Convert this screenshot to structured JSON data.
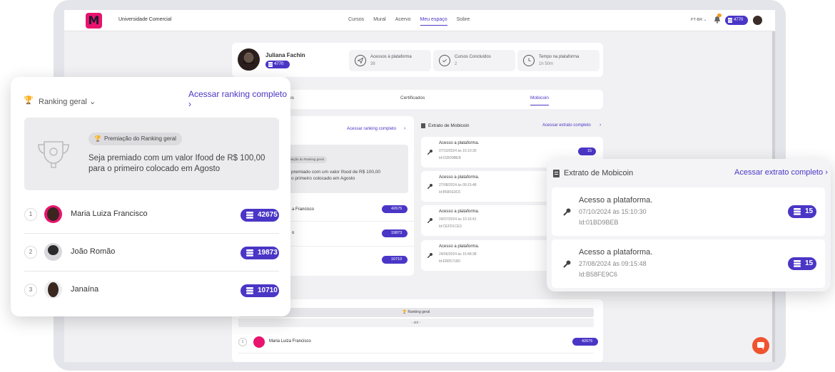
{
  "header": {
    "org_name": "Universidade Comercial",
    "nav": [
      "Cursos",
      "Mural",
      "Acervo",
      "Meu espaço",
      "Sobre"
    ],
    "lang": "PT-BR",
    "coins": "4770"
  },
  "profile": {
    "name": "Juliana Fachin",
    "coins": "4770",
    "stats": [
      {
        "label": "Acessos à plataforma",
        "value": "38"
      },
      {
        "label": "Cursos Concluídos",
        "value": "2"
      },
      {
        "label": "Tempo na plataforma",
        "value": "1h 50m"
      }
    ]
  },
  "tabs": {
    "cut_label": "os",
    "certificados": "Certificados",
    "mobicoin": "Mobicoin"
  },
  "bg_ranking": {
    "link": "Acessar ranking completo",
    "badge": "Premiação do Ranking geral",
    "text1": "premiado com um valor Ifood de R$ 100,00",
    "text2": "o primeiro colocado em Agosto",
    "rows": [
      {
        "name": "a Francisco",
        "coins": "42675"
      },
      {
        "name": "o",
        "coins": "19873"
      },
      {
        "name": "",
        "coins": "10710"
      }
    ]
  },
  "bg_extrato": {
    "title": "Extrato de Mobicoin",
    "link": "Acessar extrato completo",
    "items": [
      {
        "title": "Acesso a plataforma.",
        "date": "07/10/2024 às 15:10:30",
        "id": "Id:01BD9BEB",
        "coins": "15"
      },
      {
        "title": "Acesso a plataforma.",
        "date": "27/08/2024 às 09:15:48",
        "id": "Id:B58FE9C6",
        "coins": ""
      },
      {
        "title": "Acesso a plataforma.",
        "date": "24/07/2024 às 10:16:41",
        "id": "Id:CEFD1CE3",
        "coins": ""
      },
      {
        "title": "Acesso a plataforma.",
        "date": "24/06/2024 às 15:48:38",
        "id": "Id:E8D5719D",
        "coins": ""
      }
    ]
  },
  "bottom_ranking": {
    "label": "Ranking geral",
    "sub": "- até -",
    "row_num": "1",
    "row_name": "Maria Luiza Francisco",
    "row_coins": "42675"
  },
  "ranking_panel": {
    "dropdown": "Ranking geral",
    "link": "Acessar ranking completo",
    "badge": "Premiação do Ranking geral",
    "prize": "Seja premiado com um valor Ifood de R$ 100,00 para o primeiro colocado em Agosto",
    "rows": [
      {
        "pos": "1",
        "name": "Maria Luiza Francisco",
        "coins": "42675"
      },
      {
        "pos": "2",
        "name": "João Romão",
        "coins": "19873"
      },
      {
        "pos": "3",
        "name": "Janaína",
        "coins": "10710"
      }
    ]
  },
  "extrato_panel": {
    "title": "Extrato de Mobicoin",
    "link": "Acessar extrato completo",
    "items": [
      {
        "title": "Acesso a plataforma.",
        "date": "07/10/2024 às 15:10:30",
        "id": "Id:01BD9BEB",
        "coins": "15"
      },
      {
        "title": "Acesso a plataforma.",
        "date": "27/08/2024 às 09:15:48",
        "id": "Id:B58FE9C6",
        "coins": "15"
      }
    ]
  },
  "colors": {
    "accent": "#4a36c6",
    "brand": "#e8146e",
    "chat": "#f0532f"
  }
}
